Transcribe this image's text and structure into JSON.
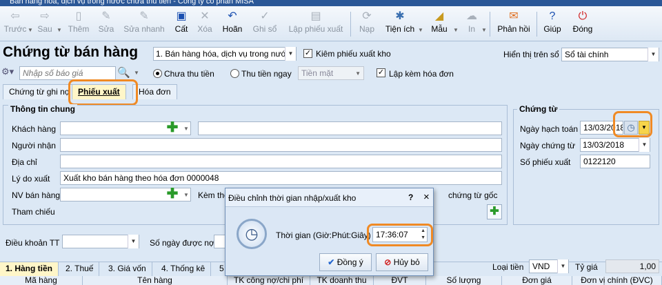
{
  "window": {
    "title": "Bán hàng hóa, dịch vụ trong nước chưa thu tiền - Công ty cổ phần MISA"
  },
  "toolbar": {
    "items": [
      {
        "label": "Trước",
        "icon": "arrow-left-icon",
        "enabled": false
      },
      {
        "label": "Sau",
        "icon": "arrow-right-icon",
        "enabled": false
      },
      {
        "label": "Thêm",
        "icon": "add-document-icon",
        "enabled": false
      },
      {
        "label": "Sửa",
        "icon": "edit-icon",
        "enabled": false
      },
      {
        "label": "Sửa nhanh",
        "icon": "quick-edit-icon",
        "enabled": false
      },
      {
        "label": "Cất",
        "icon": "save-icon",
        "enabled": true
      },
      {
        "label": "Xóa",
        "icon": "delete-icon",
        "enabled": false
      },
      {
        "label": "Hoãn",
        "icon": "undo-icon",
        "enabled": true
      },
      {
        "label": "Ghi sổ",
        "icon": "post-icon",
        "enabled": false
      },
      {
        "label": "Lập phiếu xuất",
        "icon": "export-slip-icon",
        "enabled": false
      },
      {
        "label": "Nạp",
        "icon": "reload-icon",
        "enabled": false
      },
      {
        "label": "Tiện ích",
        "icon": "utility-icon",
        "enabled": true
      },
      {
        "label": "Mẫu",
        "icon": "template-icon",
        "enabled": true
      },
      {
        "label": "In",
        "icon": "print-icon",
        "enabled": false
      },
      {
        "label": "Phản hồi",
        "icon": "feedback-icon",
        "enabled": true
      },
      {
        "label": "Giúp",
        "icon": "help-icon",
        "enabled": true
      },
      {
        "label": "Đóng",
        "icon": "close-power-icon",
        "enabled": true
      }
    ]
  },
  "header": {
    "title": "Chứng từ bán hàng",
    "type_select": "1. Bán hàng hóa, dịch vụ trong nước",
    "kiem_phieu_xuat_kho": "Kiêm phiếu xuất kho",
    "display_label": "Hiển thị trên sổ",
    "display_select": "Sổ tài chính",
    "quote_placeholder": "Nhập số báo giá",
    "radio_unpaid": "Chưa thu tiền",
    "radio_paid": "Thu tiền ngay",
    "payment_method": "Tiền mặt",
    "lap_kem_hoa_don": "Lập kèm hóa đơn"
  },
  "tabs": [
    {
      "label": "Chứng từ ghi nợ"
    },
    {
      "label": "Phiếu xuất"
    },
    {
      "label": "Hóa đơn"
    }
  ],
  "general": {
    "legend": "Thông tin chung",
    "khach_hang": "Khách hàng",
    "nguoi_nhan": "Người nhận",
    "dia_chi": "Địa chỉ",
    "ly_do_xuat": "Lý do xuất",
    "ly_do_xuat_value": "Xuất kho bán hàng theo hóa đơn 0000048",
    "nv_ban_hang": "NV bán hàng",
    "kem_theo": "Kèm the",
    "chung_tu_goc": "chứng từ gốc",
    "tham_chieu": "Tham chiếu"
  },
  "voucher": {
    "legend": "Chứng từ",
    "ngay_hach_toan": "Ngày hạch toán",
    "ngay_hach_toan_value": "13/03/2018",
    "ngay_chung_tu": "Ngày chứng từ",
    "ngay_chung_tu_value": "13/03/2018",
    "so_phieu_xuat": "Số phiếu xuất",
    "so_phieu_xuat_value": "0122120"
  },
  "terms": {
    "dieu_khoan": "Điều khoản TT",
    "so_ngay": "Số ngày được nợ"
  },
  "bottom_tabs": [
    {
      "label": "1. Hàng tiền"
    },
    {
      "label": "2. Thuế"
    },
    {
      "label": "3. Giá vốn"
    },
    {
      "label": "4. Thống kê"
    },
    {
      "label": "5"
    }
  ],
  "currency": {
    "label": "Loại tiền",
    "value": "VND",
    "rate_label": "Tỷ giá",
    "rate_value": "1,00"
  },
  "grid_columns": [
    "Mã hàng",
    "Tên hàng",
    "TK công nợ/chi phí",
    "TK doanh thu",
    "ĐVT",
    "Số lượng",
    "Đơn giá",
    "Đơn vị chính (ĐVC)"
  ],
  "dialog": {
    "title": "Điều chỉnh thời gian nhập/xuất kho",
    "help": "?",
    "close": "×",
    "label": "Thời gian (Giờ:Phút:Giây)",
    "time_value": "17:36:07",
    "ok": "Đồng ý",
    "cancel": "Hủy bỏ"
  },
  "colors": {
    "highlight": "#f08a24",
    "background": "#dce8f5",
    "titlebar": "#2b5797"
  }
}
